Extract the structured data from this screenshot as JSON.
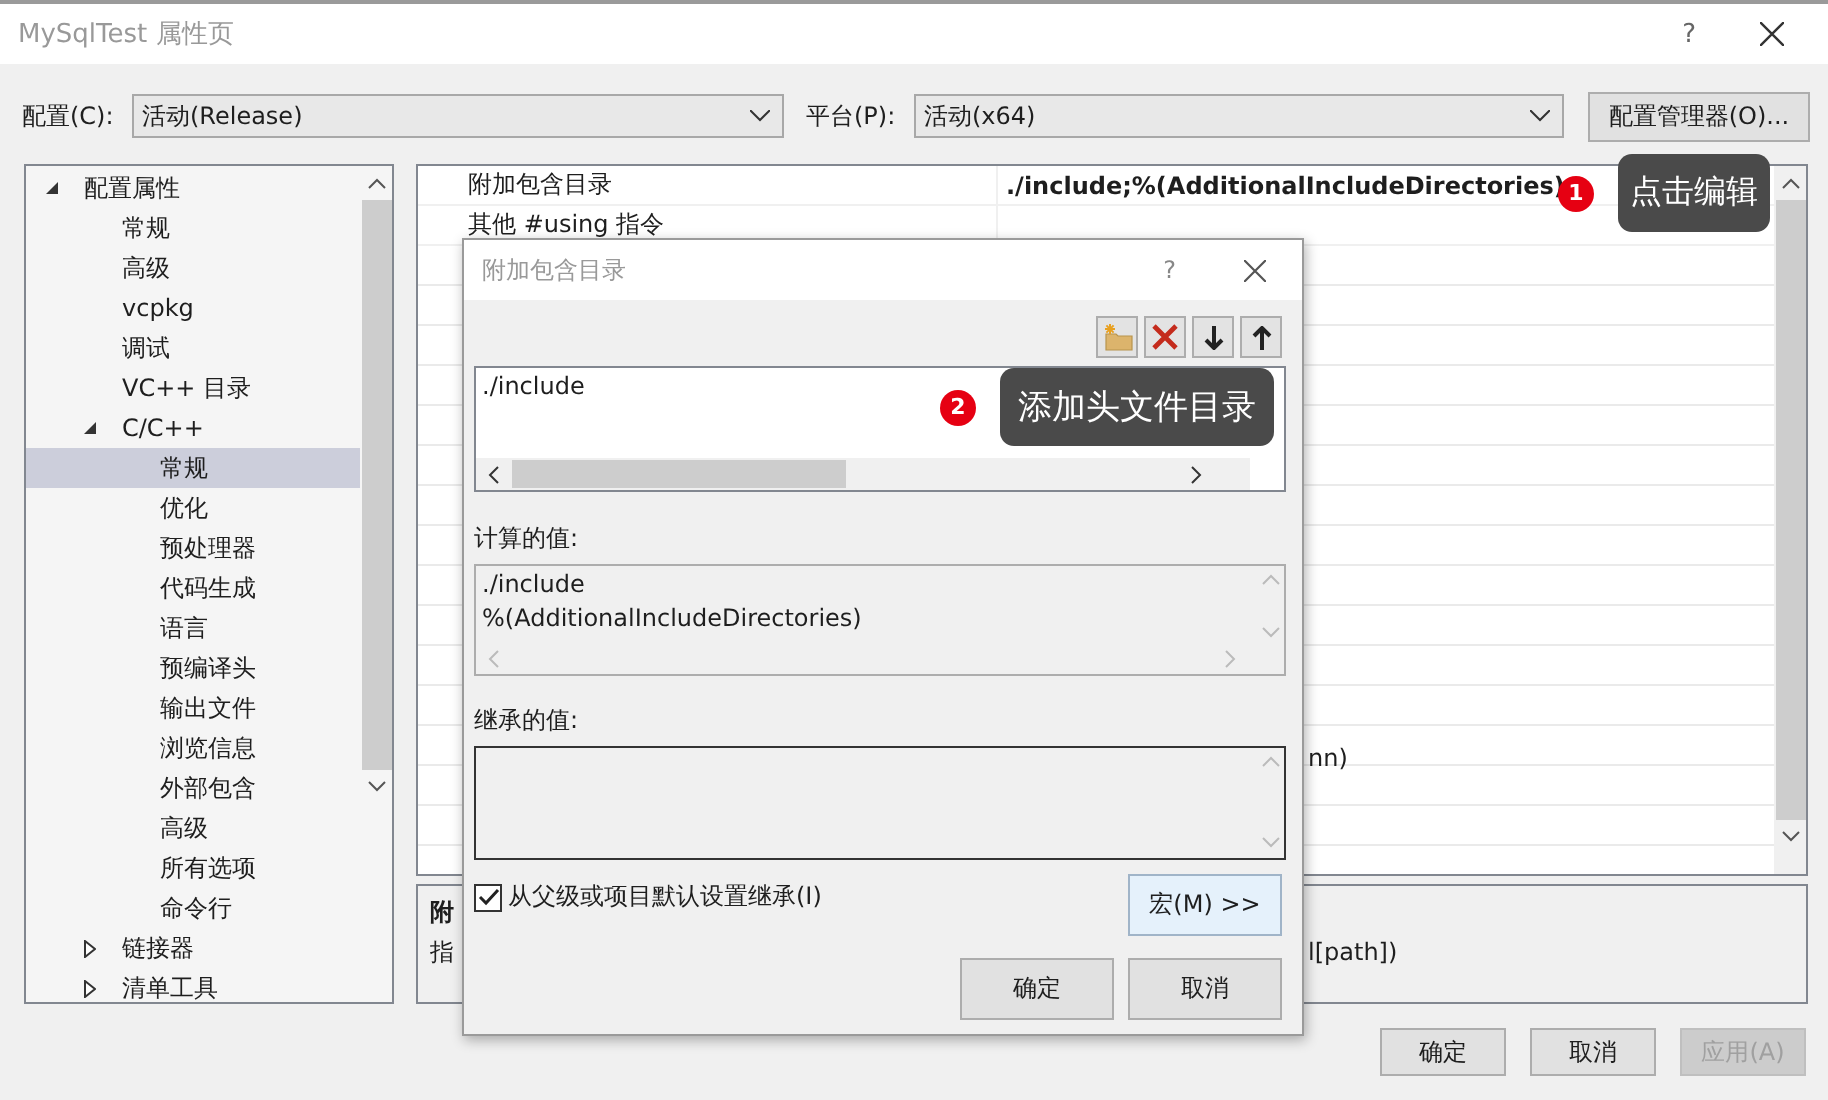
{
  "window": {
    "title": "MySqlTest 属性页",
    "help": "?"
  },
  "config": {
    "label": "配置(C):",
    "value": "活动(Release)"
  },
  "platform": {
    "label": "平台(P):",
    "value": "活动(x64)"
  },
  "manager_button": "配置管理器(O)...",
  "tree": {
    "items": [
      {
        "label": "配置属性",
        "expanded": true,
        "selected": false,
        "children": [
          {
            "label": "常规",
            "selected": false
          },
          {
            "label": "高级",
            "selected": false
          },
          {
            "label": "vcpkg",
            "selected": false
          },
          {
            "label": "调试",
            "selected": false
          },
          {
            "label": "VC++ 目录",
            "selected": false
          },
          {
            "label": "C/C++",
            "expanded": true,
            "selected": false,
            "children": [
              {
                "label": "常规",
                "selected": true
              },
              {
                "label": "优化",
                "selected": false
              },
              {
                "label": "预处理器",
                "selected": false
              },
              {
                "label": "代码生成",
                "selected": false
              },
              {
                "label": "语言",
                "selected": false
              },
              {
                "label": "预编译头",
                "selected": false
              },
              {
                "label": "输出文件",
                "selected": false
              },
              {
                "label": "浏览信息",
                "selected": false
              },
              {
                "label": "外部包含",
                "selected": false
              },
              {
                "label": "高级",
                "selected": false
              },
              {
                "label": "所有选项",
                "selected": false
              },
              {
                "label": "命令行",
                "selected": false
              }
            ]
          },
          {
            "label": "链接器",
            "expanded": false,
            "selected": false
          },
          {
            "label": "清单工具",
            "expanded": false,
            "selected": false
          }
        ]
      }
    ]
  },
  "grid": {
    "rows": [
      {
        "name": "附加包含目录",
        "value": "./include;%(AdditionalIncludeDirectories)",
        "modified": true
      },
      {
        "name": "其他 #using 指令"
      }
    ],
    "covered_value_fragment": "nn)"
  },
  "description": {
    "title_fragment": "附",
    "text_fragment": "指",
    "text_tail": "l[path])"
  },
  "dialog": {
    "title": "附加包含目录",
    "help": "?",
    "entries": [
      "./include"
    ],
    "computed_label": "计算的值:",
    "computed_lines": [
      "./include",
      "%(AdditionalIncludeDirectories)"
    ],
    "inherited_label": "继承的值:",
    "inherit": {
      "label": "从父级或项目默认设置继承(I)",
      "checked": true
    },
    "macro_button": "宏(M) >>",
    "ok": "确定",
    "cancel": "取消"
  },
  "callouts": [
    {
      "number": "1",
      "text": "点击编辑"
    },
    {
      "number": "2",
      "text": "添加头文件目录"
    }
  ],
  "footer_buttons": [
    {
      "label": "确定",
      "disabled": false
    },
    {
      "label": "取消",
      "disabled": false
    },
    {
      "label": "应用(A)",
      "disabled": true
    }
  ]
}
